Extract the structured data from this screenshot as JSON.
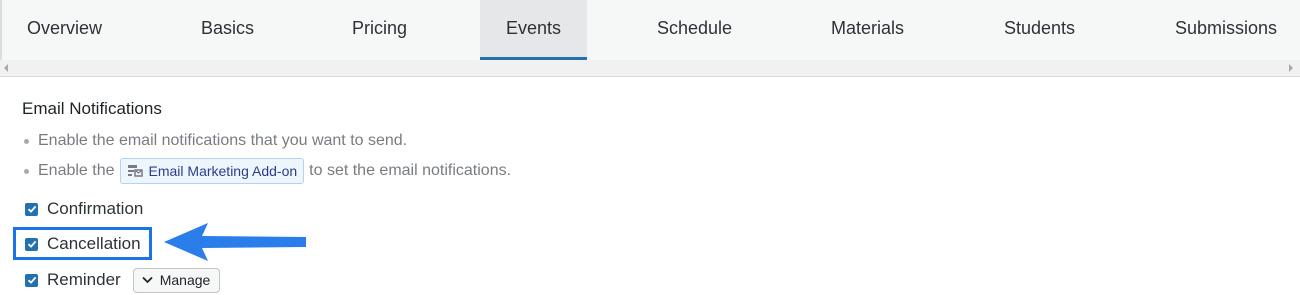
{
  "tabs": [
    {
      "label": "Overview",
      "active": false
    },
    {
      "label": "Basics",
      "active": false
    },
    {
      "label": "Pricing",
      "active": false
    },
    {
      "label": "Events",
      "active": true
    },
    {
      "label": "Schedule",
      "active": false
    },
    {
      "label": "Materials",
      "active": false
    },
    {
      "label": "Students",
      "active": false
    },
    {
      "label": "Submissions",
      "active": false
    }
  ],
  "section": {
    "title": "Email Notifications",
    "bullet1": "Enable the email notifications that you want to send.",
    "bullet2_prefix": "Enable the",
    "bullet2_link": "Email Marketing Add-on",
    "bullet2_suffix": "to set the email notifications."
  },
  "notifications": [
    {
      "label": "Confirmation",
      "checked": true
    },
    {
      "label": "Cancellation",
      "checked": true,
      "highlighted": true
    },
    {
      "label": "Reminder",
      "checked": true
    }
  ],
  "manage_label": "Manage",
  "colors": {
    "accent": "#2271b1",
    "highlight": "#1a73e8",
    "arrow": "#2b7de9"
  },
  "icons": {
    "addon": "email-addon-icon",
    "manage": "chevron-down-icon",
    "check": "checkmark-icon",
    "annotation": "pointer-arrow"
  }
}
